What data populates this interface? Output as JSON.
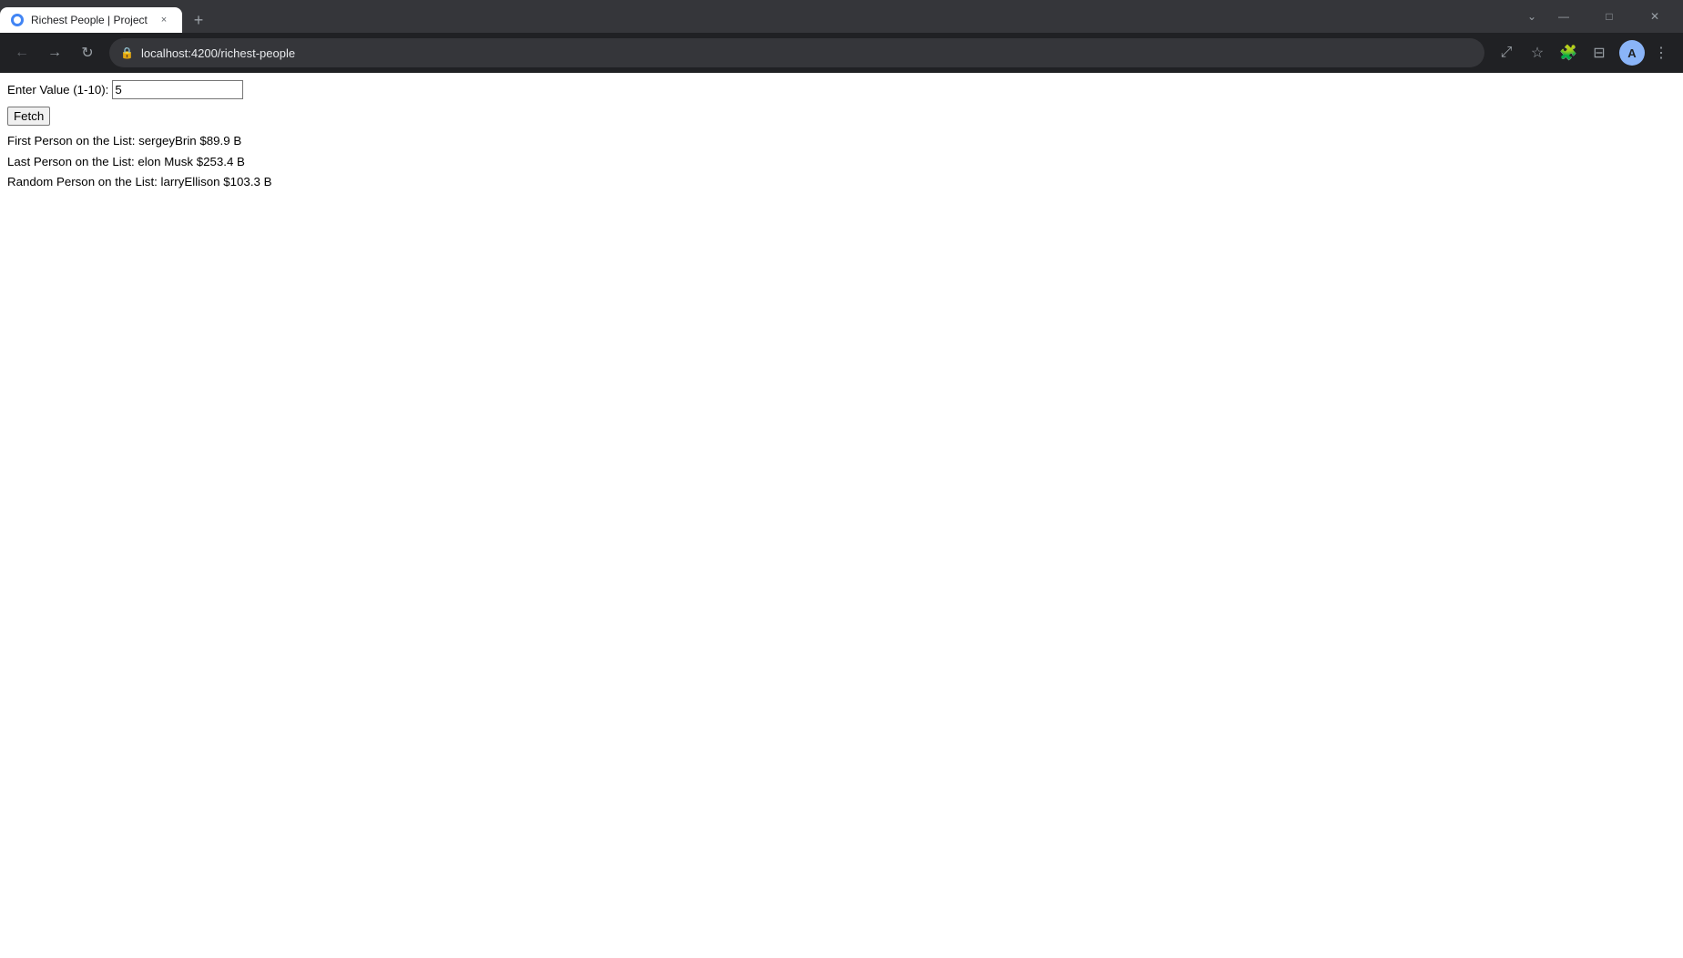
{
  "browser": {
    "tab": {
      "title": "Richest People | Project",
      "favicon_label": "favicon"
    },
    "tab_close_label": "×",
    "tab_new_label": "+",
    "window_controls": {
      "minimize": "—",
      "maximize": "□",
      "close": "✕",
      "dropdown": "⌄"
    },
    "nav": {
      "back_label": "←",
      "forward_label": "→",
      "reload_label": "↻",
      "url": "localhost:4200/richest-people",
      "share_label": "⤢",
      "bookmark_label": "☆",
      "extension_label": "🧩",
      "sidebar_label": "⊟",
      "profile_label": "A",
      "menu_label": "⋮"
    }
  },
  "page": {
    "input_label": "Enter Value (1-10):",
    "input_value": "5",
    "fetch_button_label": "Fetch",
    "results": {
      "first_person": "First Person on the List: sergeyBrin $89.9 B",
      "last_person": "Last Person on the List: elon Musk $253.4 B",
      "random_person": "Random Person on the List: larryEllison $103.3 B"
    }
  }
}
